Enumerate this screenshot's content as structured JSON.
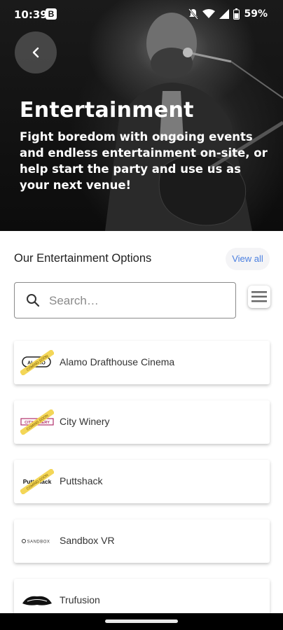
{
  "status_bar": {
    "time": "10:39",
    "app_badge": "B",
    "battery_percent": "59%",
    "icons": [
      "mute-icon",
      "wifi-icon",
      "signal-icon",
      "battery-icon"
    ]
  },
  "hero": {
    "back_icon": "chevron-left-icon",
    "title": "Entertainment",
    "description": "Fight boredom with ongoing events and endless entertainment on-site, or help start the party and use us as your next venue!"
  },
  "section": {
    "title": "Our Entertainment Options",
    "view_all_label": "View all"
  },
  "search": {
    "placeholder": "Search…",
    "value": ""
  },
  "options": [
    {
      "name": "Alamo Drafthouse Cinema",
      "logo": "alamo-logo",
      "badge": "COMING SOON"
    },
    {
      "name": "City Winery",
      "logo": "city-winery-logo",
      "badge": "COMING SOON"
    },
    {
      "name": "Puttshack",
      "logo": "puttshack-logo",
      "badge": "COMING SOON"
    },
    {
      "name": "Sandbox VR",
      "logo": "sandbox-vr-logo",
      "badge": ""
    },
    {
      "name": "Trufusion",
      "logo": "trufusion-logo",
      "badge": ""
    }
  ],
  "logo_text": {
    "alamo": "ALAMO",
    "city_winery": "CITY WINERY",
    "puttshack": "Puttshack",
    "sandbox": "SANDBOX"
  },
  "colors": {
    "accent": "#4a7fe0",
    "coming_soon_tape": "#f2d24a",
    "city_winery_brand": "#b0306a"
  }
}
